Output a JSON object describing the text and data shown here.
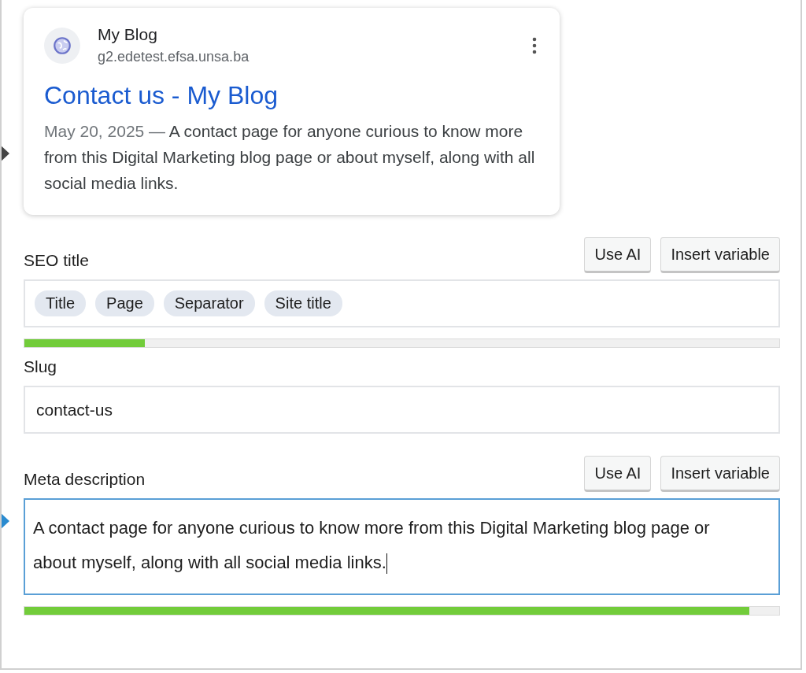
{
  "preview": {
    "site_name": "My Blog",
    "url": "g2.edetest.efsa.unsa.ba",
    "title": "Contact us - My Blog",
    "date": "May 20, 2025",
    "separator": "—",
    "description": "A contact page for anyone curious to know more from this Digital Marketing blog page or about myself, along with all social media links."
  },
  "fields": [
    {
      "kind": "variables",
      "label": "SEO title",
      "buttons": [
        "Use AI",
        "Insert variable"
      ],
      "variables": [
        "Title",
        "Page",
        "Separator",
        "Site title"
      ],
      "level": 0.16,
      "focused": false
    },
    {
      "kind": "text",
      "label": "Slug",
      "value": "contact-us",
      "focused": false
    },
    {
      "kind": "textarea",
      "label": "Meta description",
      "buttons": [
        "Use AI",
        "Insert variable"
      ],
      "value": "A contact page for anyone curious to know more from this Digital Marketing blog page or about myself, along with all social media links.",
      "level": 0.96,
      "focused": true
    }
  ]
}
